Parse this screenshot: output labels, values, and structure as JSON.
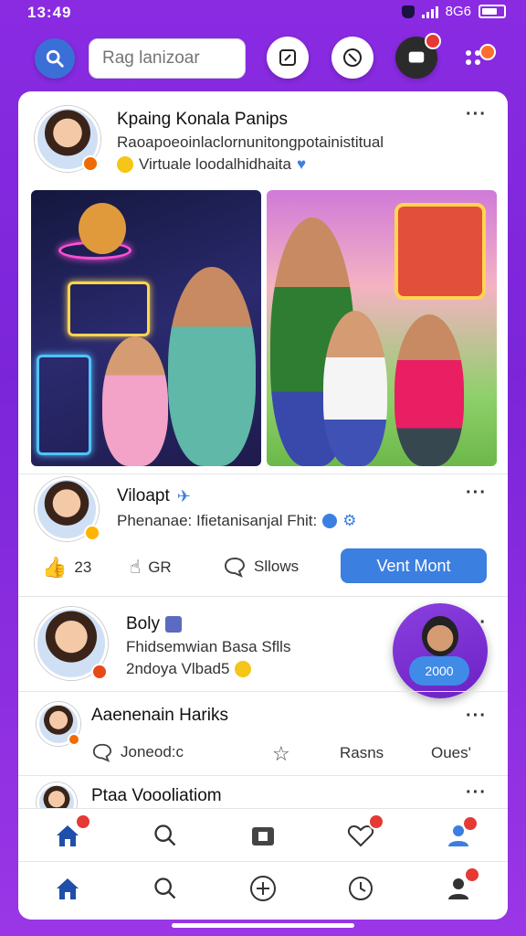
{
  "status": {
    "time": "13:49",
    "right_text": "8G6"
  },
  "search": {
    "placeholder": "Rag lanizoar"
  },
  "post1": {
    "author": "Kpaing Konala Panips",
    "line1": "Raoapoeoinlaclornunitongpotainistitual",
    "line2": "Virtuale loodalhidhaita"
  },
  "post2": {
    "author": "Viloapt",
    "line1": "Phenanae: Ifietanisanjal Fhit:",
    "actions": {
      "like": "23",
      "unlike": "GR",
      "comment": "Sllows",
      "primary": "Vent Mont"
    }
  },
  "post3": {
    "author": "Boly",
    "line1": "Fhidsemwian Basa Sflls",
    "line2": "2ndoya Vlbad5",
    "fab_label": "2000"
  },
  "post4": {
    "author": "Aaenenain Hariks",
    "actions": {
      "a": "Joneod:c",
      "b": "Rasns",
      "c": "Oues'"
    }
  },
  "post5": {
    "author": "Ptaa Voooliatiom"
  },
  "colors": {
    "accent": "#3b7fe0",
    "brand": "#8a2be2",
    "badge": "#e53935"
  }
}
